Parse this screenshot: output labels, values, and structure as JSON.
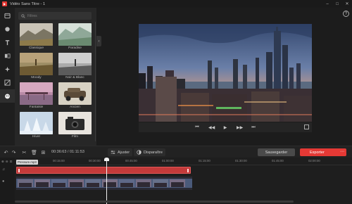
{
  "window": {
    "title": "Vidéo Sans Titre - 1"
  },
  "rail": {
    "items": [
      {
        "name": "media-icon"
      },
      {
        "name": "audio-icon"
      },
      {
        "name": "text-icon"
      },
      {
        "name": "transitions-icon"
      },
      {
        "name": "effects-icon"
      },
      {
        "name": "overlays-icon"
      },
      {
        "name": "filters-icon",
        "active": true
      }
    ]
  },
  "filters_panel": {
    "search_placeholder": "Filtres",
    "items": [
      {
        "label": "Classique"
      },
      {
        "label": "Paradise"
      },
      {
        "label": "Moody"
      },
      {
        "label": "Noir & Blanc"
      },
      {
        "label": "Fantaisie"
      },
      {
        "label": "Ancien"
      },
      {
        "label": "Hiver"
      },
      {
        "label": "Film"
      }
    ]
  },
  "toolbar": {
    "time": "00:36:63 / 01:11:53",
    "adjust_label": "Ajuster",
    "disappear_label": "Disparaître",
    "save_label": "Sauvegarder",
    "export_label": "Exporter"
  },
  "timeline": {
    "ticks": [
      "00:00:00",
      "00:15:00",
      "00:30:00",
      "00:45:00",
      "01:00:00",
      "01:15:00",
      "01:30:00",
      "01:45:00",
      "02:00:00"
    ],
    "clip_name": "Pressure.mp3",
    "colors": {
      "audio_clip": "#c33a3a",
      "accent": "#e53935"
    }
  }
}
